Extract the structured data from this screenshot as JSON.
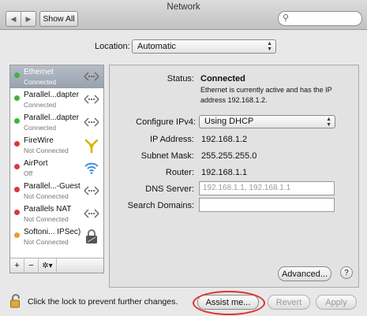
{
  "window": {
    "title": "Network"
  },
  "toolbar": {
    "back_glyph": "◀",
    "forward_glyph": "▶",
    "show_all_label": "Show All",
    "search_value": ""
  },
  "location": {
    "label": "Location:",
    "value": "Automatic"
  },
  "services": [
    {
      "name": "Ethernet",
      "state": "Connected",
      "status_color": "#3fb43f",
      "icon": "ethernet-icon",
      "selected": true
    },
    {
      "name": "Parallel...dapter",
      "state": "Connected",
      "status_color": "#3fb43f",
      "icon": "ethernet-icon",
      "selected": false
    },
    {
      "name": "Parallel...dapter",
      "state": "Connected",
      "status_color": "#3fb43f",
      "icon": "ethernet-icon",
      "selected": false
    },
    {
      "name": "FireWire",
      "state": "Not Connected",
      "status_color": "#d83a3a",
      "icon": "firewire-icon",
      "selected": false
    },
    {
      "name": "AirPort",
      "state": "Off",
      "status_color": "#d83a3a",
      "icon": "wifi-icon",
      "selected": false
    },
    {
      "name": "Parallel...-Guest",
      "state": "Not Connected",
      "status_color": "#d83a3a",
      "icon": "ethernet-icon",
      "selected": false
    },
    {
      "name": "Parallels NAT",
      "state": "Not Connected",
      "status_color": "#d83a3a",
      "icon": "ethernet-icon",
      "selected": false
    },
    {
      "name": "Softoni... IPSec)",
      "state": "Not Connected",
      "status_color": "#e6a02a",
      "icon": "vpn-lock-icon",
      "selected": false
    }
  ],
  "sidebar_controls": {
    "add": "+",
    "remove": "−",
    "action": "✲▾"
  },
  "details": {
    "status_label": "Status:",
    "status_value": "Connected",
    "status_description": "Ethernet is currently active and has the IP address 192.168.1.2.",
    "configure_label": "Configure IPv4:",
    "configure_value": "Using DHCP",
    "ip_label": "IP Address:",
    "ip_value": "192.168.1.2",
    "subnet_label": "Subnet Mask:",
    "subnet_value": "255.255.255.0",
    "router_label": "Router:",
    "router_value": "192.168.1.1",
    "dns_label": "DNS Server:",
    "dns_placeholder": "192.168.1.1, 192.168.1.1",
    "search_domains_label": "Search Domains:",
    "search_domains_value": ""
  },
  "buttons": {
    "advanced": "Advanced...",
    "help": "?",
    "assist": "Assist me...",
    "revert": "Revert",
    "apply": "Apply"
  },
  "footer": {
    "lock_text": "Click the lock to prevent further changes."
  },
  "colors": {
    "selection": "#a8b0bb",
    "annotation_circle": "#dd3333"
  }
}
